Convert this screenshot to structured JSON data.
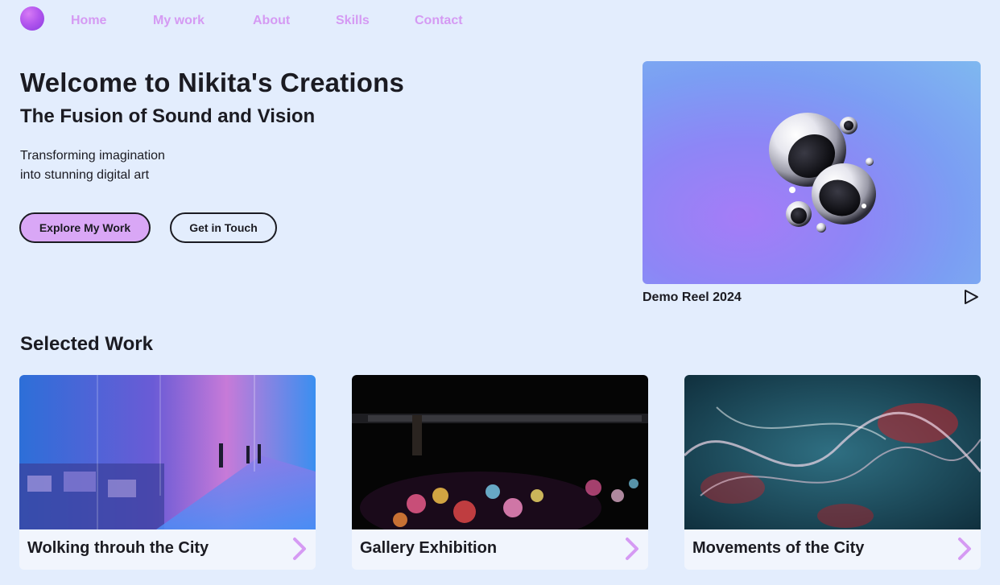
{
  "nav": {
    "items": [
      {
        "label": "Home"
      },
      {
        "label": "My work"
      },
      {
        "label": "About"
      },
      {
        "label": "Skills"
      },
      {
        "label": "Contact"
      }
    ]
  },
  "hero": {
    "title": "Welcome to Nikita's Creations",
    "subtitle": "The Fusion of Sound and Vision",
    "description_line1": "Transforming imagination",
    "description_line2": "into stunning digital art",
    "primary_button": "Explore My Work",
    "secondary_button": "Get in Touch"
  },
  "demo": {
    "label": "Demo Reel 2024"
  },
  "selected_work": {
    "title": "Selected Work",
    "cards": [
      {
        "title": "Wolking throuh the City"
      },
      {
        "title": "Gallery Exhibition"
      },
      {
        "title": "Movements of the City"
      }
    ]
  },
  "colors": {
    "background": "#e3edfd",
    "accent": "#d59af3",
    "primary_button": "#d9a7f6",
    "text": "#1b1b22"
  }
}
